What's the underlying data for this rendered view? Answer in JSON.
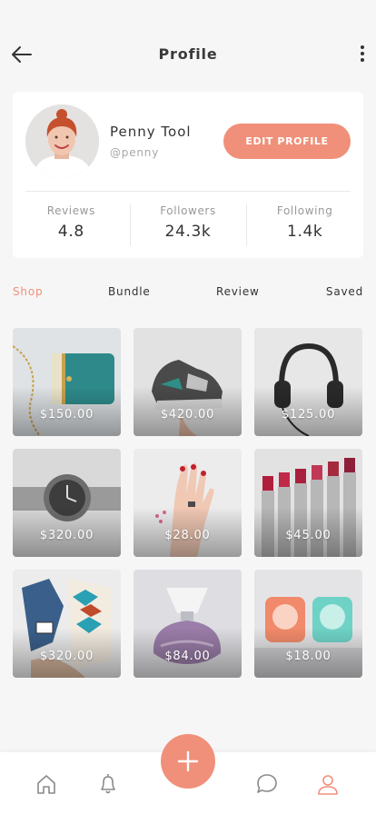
{
  "header": {
    "title": "Profile"
  },
  "profile": {
    "name": "Penny Tool",
    "handle": "@penny",
    "edit_label": "EDIT PROFILE"
  },
  "stats": [
    {
      "label": "Reviews",
      "value": "4.8"
    },
    {
      "label": "Followers",
      "value": "24.3k"
    },
    {
      "label": "Following",
      "value": "1.4k"
    }
  ],
  "tabs": [
    {
      "label": "Shop",
      "active": true
    },
    {
      "label": "Bundle",
      "active": false
    },
    {
      "label": "Review",
      "active": false
    },
    {
      "label": "Saved",
      "active": false
    }
  ],
  "products": [
    {
      "price": "$150.00",
      "icon": "clutch-bag"
    },
    {
      "price": "$420.00",
      "icon": "sneaker"
    },
    {
      "price": "$125.00",
      "icon": "headphones"
    },
    {
      "price": "$320.00",
      "icon": "wristwatch"
    },
    {
      "price": "$28.00",
      "icon": "hand-rings"
    },
    {
      "price": "$45.00",
      "icon": "lipsticks"
    },
    {
      "price": "$320.00",
      "icon": "clothes"
    },
    {
      "price": "$84.00",
      "icon": "perfume"
    },
    {
      "price": "$18.00",
      "icon": "desk-fans"
    }
  ],
  "nav": [
    {
      "icon": "home-icon"
    },
    {
      "icon": "bell-icon"
    },
    {
      "icon": "plus-icon"
    },
    {
      "icon": "chat-icon"
    },
    {
      "icon": "user-icon",
      "active": true
    }
  ],
  "colors": {
    "accent": "#f0907a",
    "background": "#f6f6f6",
    "text": "#333333",
    "muted": "#999999"
  }
}
